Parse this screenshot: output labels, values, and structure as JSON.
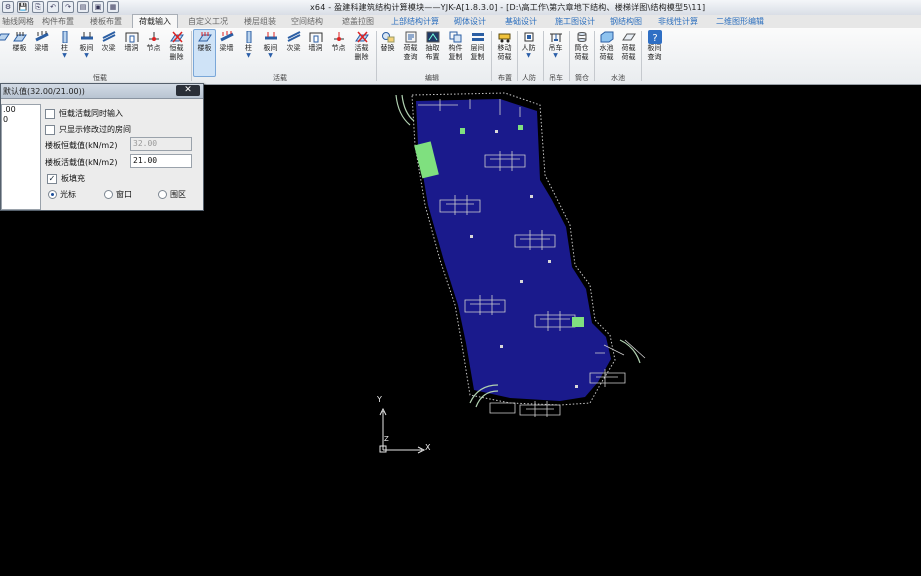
{
  "window": {
    "title": "x64 - 盈建科建筑结构计算模块——YJK-A[1.8.3.0] - [D:\\高工作\\第六章地下结构、楼梯详图\\结构模型5\\11]",
    "quick_access": [
      "⚙",
      "💾",
      "⎘",
      "↶",
      "↷",
      "▤",
      "▣",
      "▦"
    ]
  },
  "tabs": [
    {
      "label": "轴线网格"
    },
    {
      "label": "构件布置"
    },
    {
      "label": "楼板布置"
    },
    {
      "label": "荷载输入"
    },
    {
      "label": "自定义工况"
    },
    {
      "label": "楼层组装"
    },
    {
      "label": "空间结构"
    },
    {
      "label": "遮盖拉图"
    },
    {
      "label": "上部结构计算"
    },
    {
      "label": "砌体设计"
    },
    {
      "label": "基础设计"
    },
    {
      "label": "施工图设计"
    },
    {
      "label": "钢结构图"
    },
    {
      "label": "非线性计算"
    },
    {
      "label": "二维图形编辑"
    }
  ],
  "ribbon": {
    "tools": [
      {
        "label": "",
        "icon": "slab-icon"
      },
      {
        "label": "楼板",
        "icon": "slab-icon"
      },
      {
        "label": "梁墙",
        "icon": "beam-wall-icon"
      },
      {
        "label": "柱",
        "icon": "column-icon"
      },
      {
        "label": "板间",
        "icon": "between-slab-icon"
      },
      {
        "label": "次梁",
        "icon": "secondary-beam-icon"
      },
      {
        "label": "墙洞",
        "icon": "wall-opening-icon"
      },
      {
        "label": "节点",
        "icon": "node-icon"
      },
      {
        "label": "恒载\n删除",
        "icon": "dead-load-delete-icon"
      },
      {
        "label": "楼板",
        "icon": "slab-live-icon"
      },
      {
        "label": "梁墙",
        "icon": "beam-wall-icon"
      },
      {
        "label": "柱",
        "icon": "column-icon"
      },
      {
        "label": "板间",
        "icon": "between-slab-icon"
      },
      {
        "label": "次梁",
        "icon": "secondary-beam-icon"
      },
      {
        "label": "墙洞",
        "icon": "wall-opening-icon"
      },
      {
        "label": "节点",
        "icon": "node-icon"
      },
      {
        "label": "活载\n删除",
        "icon": "live-load-delete-icon"
      },
      {
        "label": "替换",
        "icon": "replace-icon"
      },
      {
        "label": "荷载\n查询",
        "icon": "load-query-icon"
      },
      {
        "label": "抽取\n布置",
        "icon": "extract-layout-icon"
      },
      {
        "label": "构件\n复制",
        "icon": "member-copy-icon"
      },
      {
        "label": "层间\n复制",
        "icon": "floor-copy-icon"
      },
      {
        "label": "移动\n荷载",
        "icon": "moving-load-icon"
      },
      {
        "label": "人防",
        "icon": "civil-defense-icon"
      },
      {
        "label": "吊车",
        "icon": "crane-icon"
      },
      {
        "label": "筒仓\n荷载",
        "icon": "silo-load-icon"
      },
      {
        "label": "水池\n荷载",
        "icon": "pool-load-icon"
      },
      {
        "label": "荷载\n荷载",
        "icon": "load-icon"
      },
      {
        "label": "板间\n查询",
        "icon": "slab-query-icon"
      }
    ],
    "groups": [
      {
        "label": "恒载"
      },
      {
        "label": "活载"
      },
      {
        "label": "编辑"
      },
      {
        "label": "布置"
      },
      {
        "label": "人防"
      },
      {
        "label": "吊车"
      },
      {
        "label": "筒仓"
      },
      {
        "label": "水池"
      }
    ]
  },
  "dialog": {
    "title": "默认值(32.00/21.00))",
    "close_label": "✕",
    "list_items": [
      ".00",
      "0"
    ],
    "chk_dead_live": "恒载活载同时输入",
    "chk_only_modified": "只显示修改过的房间",
    "dead_label": "楼板恒载值(kN/m2)",
    "dead_value": "32.00",
    "live_label": "楼板活载值(kN/m2)",
    "live_value": "21.00",
    "chk_fill": "板填充",
    "fill_checked": "✓",
    "radio_cursor": "光标",
    "radio_window": "窗口",
    "radio_region": "围区"
  },
  "canvas": {
    "axis_x": "X",
    "axis_y": "Y",
    "axis_z": "Z",
    "slab_fill_color": "#1a1a8c",
    "highlight_color": "#7fe07f"
  }
}
